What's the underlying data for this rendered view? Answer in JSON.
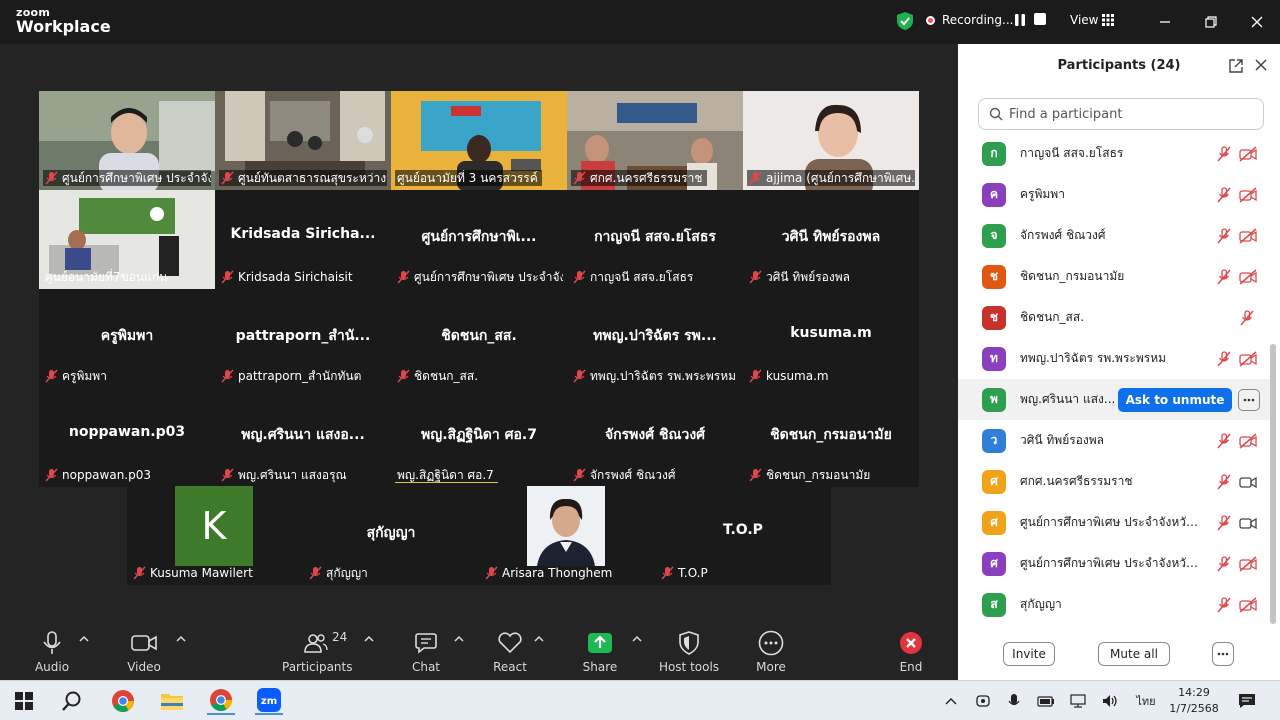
{
  "titlebar": {
    "brand_line1": "zoom",
    "brand_line2": "Workplace",
    "recording_label": "Recording...",
    "view_label": "View"
  },
  "colors": {
    "accent": "#0e71eb",
    "active_speaker": "#4ed17b",
    "muted_red": "#e0474c",
    "share_green": "#1db954"
  },
  "gallery": {
    "video_tiles": [
      {
        "name": "ศูนย์การศึกษาพิเศษ ประจำจังหวัด..."
      },
      {
        "name": "ศูนย์ทันตสาธารณสุขระหว่างประเทศ..."
      },
      {
        "name": "ศูนย์อนามัยที่ 3 นครสวรรค์"
      },
      {
        "name": "ศกศ.นครศรีธรรมราช"
      },
      {
        "name": "ajjima (ศูนย์การศึกษาพิเศษ..."
      },
      {
        "name": "ศูนย์อนามัยที่7ขอนแก่น"
      }
    ],
    "name_tiles": [
      {
        "display": "Kridsada  Siricha...",
        "label": "Kridsada Sirichaisit"
      },
      {
        "display": "ศูนย์การศึกษาพิเ...",
        "label": "ศูนย์การศึกษาพิเศษ ประจำจัง..."
      },
      {
        "display": "กาญจนี สสจ.ยโสธร",
        "label": "กาญจนี สสจ.ยโสธร"
      },
      {
        "display": "วศินี ทิพย์รองพล",
        "label": "วศินี ทิพย์รองพล"
      },
      {
        "display": "ครูพิมพา",
        "label": "ครูพิมพา"
      },
      {
        "display": "pattraporn_สำนั...",
        "label": "pattraporn_สำนักทันต"
      },
      {
        "display": "ชิดชนก_สส.",
        "label": "ชิดชนก_สส."
      },
      {
        "display": "ทพญ.ปาริฉัตร รพ...",
        "label": "ทพญ.ปาริฉัตร รพ.พระพรหม"
      },
      {
        "display": "kusuma.m",
        "label": "kusuma.m"
      },
      {
        "display": "noppawan.p03",
        "label": "noppawan.p03"
      },
      {
        "display": "พญ.ศรินนา แสงอ...",
        "label": "พญ.ศรินนา แสงอรุณ"
      },
      {
        "display": "พญ.สิฏฐินิดา ศอ.7",
        "label": "พญ.สิฏฐินิดา ศอ.7"
      },
      {
        "display": "จักรพงศ์ ชิณวงศ์",
        "label": "จักรพงศ์ ชิณวงศ์"
      },
      {
        "display": "ชิดชนก_กรมอนามัย",
        "label": "ชิดชนก_กรมอนามัย"
      }
    ],
    "bottom_row": [
      {
        "avatar_letter": "K",
        "display": "",
        "label": "Kusuma Mawilert"
      },
      {
        "avatar_letter": "",
        "display": "สุกัญญา",
        "label": "สุกัญญา"
      },
      {
        "avatar_letter": "",
        "display": "",
        "label": "Arisara Thonghem"
      },
      {
        "avatar_letter": "",
        "display": "T.O.P",
        "label": "T.O.P"
      }
    ]
  },
  "toolbar": {
    "audio": "Audio",
    "video": "Video",
    "participants": "Participants",
    "participants_count": "24",
    "chat": "Chat",
    "react": "React",
    "share": "Share",
    "host_tools": "Host tools",
    "more": "More",
    "end": "End"
  },
  "panel": {
    "title": "Participants (24)",
    "search_placeholder": "Find a participant",
    "ask_to_unmute": "Ask to unmute",
    "invite": "Invite",
    "mute_all": "Mute all",
    "participants": [
      {
        "initial": "ก",
        "name": "กาญจนี สสจ.ยโสธร",
        "color": "#2e9f4e",
        "cam": "off"
      },
      {
        "initial": "ค",
        "name": "ครูพิมพา",
        "color": "#8a3fbf",
        "cam": "off"
      },
      {
        "initial": "จ",
        "name": "จักรพงศ์ ชิณวงศ์",
        "color": "#2e9f4e",
        "cam": "off"
      },
      {
        "initial": "ช",
        "name": "ชิดชนก_กรมอนามัย",
        "color": "#e0570f",
        "cam": "off"
      },
      {
        "initial": "ช",
        "name": "ชิดชนก_สส.",
        "color": "#c8322d",
        "cam": "none"
      },
      {
        "initial": "ท",
        "name": "ทพญ.ปาริฉัตร รพ.พระพรหม",
        "color": "#8a3fbf",
        "cam": "off"
      },
      {
        "initial": "พ",
        "name": "พญ.ศรินนา แสง...",
        "color": "#2e9f4e",
        "cam": "ask"
      },
      {
        "initial": "ว",
        "name": "วศินี ทิพย์รองพล",
        "color": "#2f7fd8",
        "cam": "off"
      },
      {
        "initial": "ศ",
        "name": "ศกศ.นครศรีธรรมราช",
        "color": "#f0a21a",
        "cam": "on"
      },
      {
        "initial": "ศ",
        "name": "ศูนย์การศึกษาพิเศษ ประจำจังหวัดกา...",
        "color": "#f0a21a",
        "cam": "on"
      },
      {
        "initial": "ศ",
        "name": "ศูนย์การศึกษาพิเศษ ประจำจังหวัดตาก",
        "color": "#8a3fbf",
        "cam": "off"
      },
      {
        "initial": "ส",
        "name": "สุกัญญา",
        "color": "#2e9f4e",
        "cam": "off"
      }
    ]
  },
  "taskbar": {
    "language": "ไทย",
    "time": "14:29",
    "date": "1/7/2568"
  }
}
